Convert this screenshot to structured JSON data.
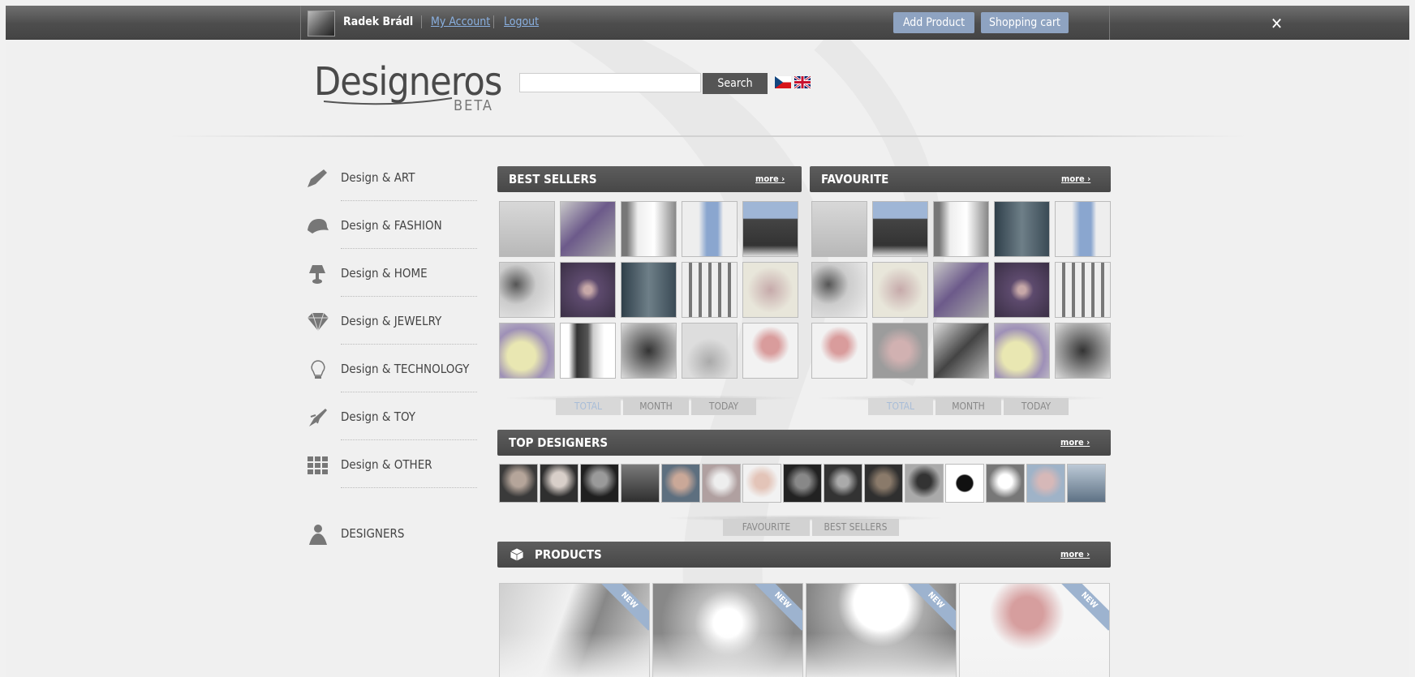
{
  "topbar": {
    "username": "Radek Brádl",
    "my_account": "My Account",
    "logout": "Logout",
    "add_product": "Add Product",
    "shopping_cart": "Shopping cart",
    "close": "✕"
  },
  "header": {
    "logo": "Designeros",
    "beta": "BETA",
    "search_value": "",
    "search_button": "Search",
    "languages": [
      "cs-flag",
      "uk-flag"
    ]
  },
  "sidebar": {
    "categories": [
      {
        "label": "Design & ART",
        "icon": "brush-icon"
      },
      {
        "label": "Design & FASHION",
        "icon": "cap-icon"
      },
      {
        "label": "Design & HOME",
        "icon": "lamp-icon"
      },
      {
        "label": "Design & JEWELRY",
        "icon": "diamond-icon"
      },
      {
        "label": "Design & TECHNOLOGY",
        "icon": "lightbulb-icon"
      },
      {
        "label": "Design & TOY",
        "icon": "rocket-icon"
      },
      {
        "label": "Design & OTHER",
        "icon": "grid-icon"
      }
    ],
    "designers": {
      "label": "DESIGNERS",
      "icon": "person-icon"
    }
  },
  "best_sellers": {
    "title": "BEST SELLERS",
    "more": "more ›",
    "tabs": [
      "TOTAL",
      "MONTH",
      "TODAY"
    ],
    "active_tab": "TOTAL"
  },
  "favourite": {
    "title": "FAVOURITE",
    "more": "more ›",
    "tabs": [
      "TOTAL",
      "MONTH",
      "TODAY"
    ],
    "active_tab": "TOTAL"
  },
  "top_designers": {
    "title": "TOP DESIGNERS",
    "more": "more ›",
    "tabs": [
      "FAVOURITE",
      "BEST SELLERS"
    ]
  },
  "products": {
    "title": "PRODUCTS",
    "more": "more ›",
    "badge": "NEW"
  },
  "colors": {
    "topbar": "#4d4d4d",
    "accent_button": "#8ea3c1",
    "section_header": "#4f4f4f",
    "link": "#8ab0e0"
  }
}
